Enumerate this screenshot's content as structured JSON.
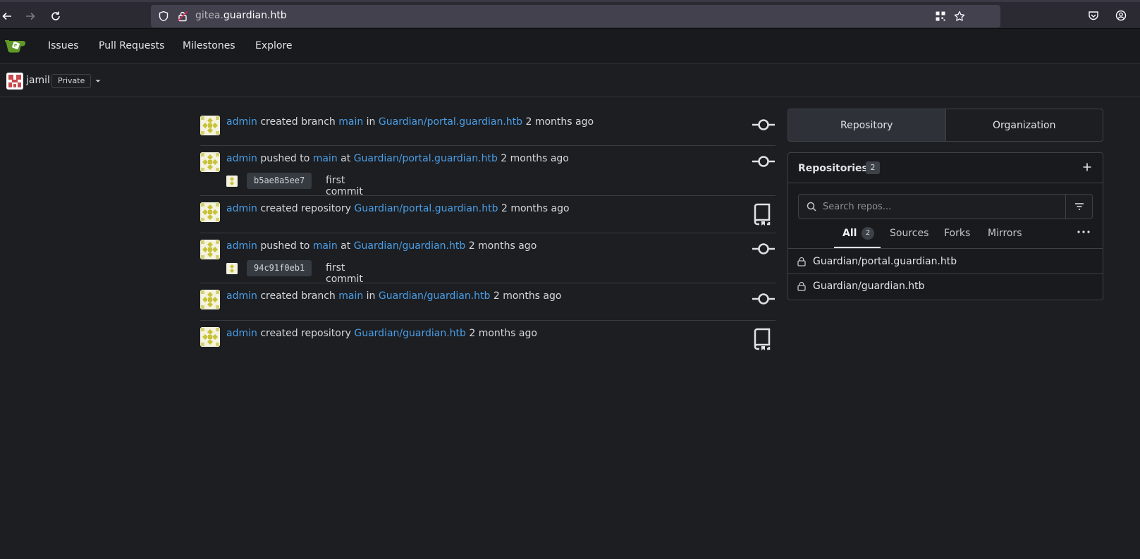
{
  "browser": {
    "url_subdomain": "gitea.",
    "url_host": "guardian.htb"
  },
  "nav": {
    "items": [
      "Issues",
      "Pull Requests",
      "Milestones",
      "Explore"
    ]
  },
  "context": {
    "username": "jamil",
    "badge": "Private"
  },
  "feed": [
    {
      "actor": "admin",
      "action": "created branch",
      "branch": "main",
      "prep": "in",
      "repo": "Guardian/portal.guardian.htb",
      "time": "2 months ago",
      "icon": "commit-icon"
    },
    {
      "actor": "admin",
      "action": "pushed to",
      "branch": "main",
      "prep": "at",
      "repo": "Guardian/portal.guardian.htb",
      "time": "2 months ago",
      "icon": "commit-icon",
      "commit": {
        "sha": "b5ae8a5ee7",
        "message": "first commit"
      }
    },
    {
      "actor": "admin",
      "action": "created repository",
      "repo": "Guardian/portal.guardian.htb",
      "time": "2 months ago",
      "icon": "repo-icon"
    },
    {
      "actor": "admin",
      "action": "pushed to",
      "branch": "main",
      "prep": "at",
      "repo": "Guardian/guardian.htb",
      "time": "2 months ago",
      "icon": "commit-icon",
      "commit": {
        "sha": "94c91f0eb1",
        "message": "first commit"
      }
    },
    {
      "actor": "admin",
      "action": "created branch",
      "branch": "main",
      "prep": "in",
      "repo": "Guardian/guardian.htb",
      "time": "2 months ago",
      "icon": "commit-icon"
    },
    {
      "actor": "admin",
      "action": "created repository",
      "repo": "Guardian/guardian.htb",
      "time": "2 months ago",
      "icon": "repo-icon"
    }
  ],
  "sidebar": {
    "switcher": {
      "repository": "Repository",
      "organization": "Organization"
    },
    "panel": {
      "title": "Repositories",
      "count": "2",
      "search_placeholder": "Search repos...",
      "tabs": {
        "all": "All",
        "all_count": "2",
        "sources": "Sources",
        "forks": "Forks",
        "mirrors": "Mirrors"
      },
      "repos": [
        "Guardian/portal.guardian.htb",
        "Guardian/guardian.htb"
      ]
    }
  },
  "colors": {
    "link": "#4b9ee6",
    "background": "#1c1e22",
    "avatar_identicon": "#c8c23a"
  }
}
